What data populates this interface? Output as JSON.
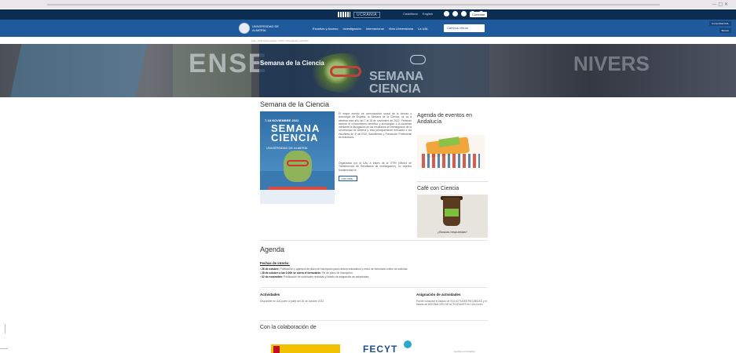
{
  "topbar": {
    "brand": "UCRANIA",
    "languages": [
      "Castellano",
      "English"
    ],
    "social_icons": [
      "instagram-icon",
      "flickr-icon",
      "twitter-icon",
      "youtube-icon",
      "facebook-icon"
    ],
    "login_label": "Conectar"
  },
  "nav": {
    "university_name": "UNIVERSIDAD DE ALMERÍA",
    "items": [
      "Estudios y Acceso",
      "Investigación",
      "Internacional",
      "Vida Universitaria",
      "La UAL"
    ],
    "campus_label": "Campus virtual",
    "right_buttons": [
      "Comunidad UAL",
      "Buscar"
    ]
  },
  "breadcrumb": "UAL › Vida Universitaria › OTRI › Divulgación científica",
  "hero": {
    "title": "Semana de la Ciencia",
    "bg_word_left": "ENSE",
    "bg_word_right": "NIVERS",
    "bg_word_semana": "SEMANA\nCIENCIA"
  },
  "main": {
    "heading": "Semana de la Ciencia",
    "poster": {
      "dates": "7-18 NOVIEMBRE 2022",
      "title": "SEMANA\nCIENCIA",
      "subtitle": "UNIVERSIDAD DE ALMERÍA"
    },
    "paragraph1": "El mayor evento de comunicación social de la ciencia y tecnología de España, la Semana de la Ciencia, se va a celebrar este año del 7 al 18 de noviembre de 2022. Pretende acercar el conocimiento científico y tecnológico a la sociedad mediante la divulgación de los resultados de investigación de la Universidad de Almería y está principalmente enfocada a los escolares de 4º de ESO, Bachillerato y Formación Profesional de Andalucía.",
    "paragraph2": "Organizada por la UAL a través de la OTRI (Oficina de Transferencia de Resultados de Investigación), su objetivo fundamental es",
    "read_more": "Leer más"
  },
  "sidebar": {
    "agenda_title": "Agenda de eventos en Andalucía",
    "cafe_title": "Café con Ciencia",
    "cafe_caption": "¿Buscas respuestas?"
  },
  "agenda": {
    "heading": "Agenda",
    "fechas_label": "Fechas de interés:",
    "items": [
      {
        "date": "26 de octubre:",
        "text": "Publicación y apertura de plazo de inscripción para centros educativos y envío de formulario online de solicitud."
      },
      {
        "date": "28 de octubre a las 0:00h se cierra el formulario:",
        "text": "Fin de plazo de inscripción."
      },
      {
        "date": "02 de noviembre:",
        "text": "Publicación de solicitudes recibidas y listado de asignación de actividades."
      }
    ]
  },
  "actividades": {
    "title": "Actividades",
    "text": "Disponible en UALjoven a partir del 26 de octubre 2022."
  },
  "asignacion": {
    "title": "Asignación de actividades",
    "text": "Puede consultar el listado de SOLICITUDES RECIBIDAS y el listado de ASIGNACIÓN DE ACTIVIDADES en UALJoven"
  },
  "colaboracion": {
    "heading": "Con la colaboración de",
    "logo2": "FECYT",
    "logo3": "ciencia e innovación"
  }
}
